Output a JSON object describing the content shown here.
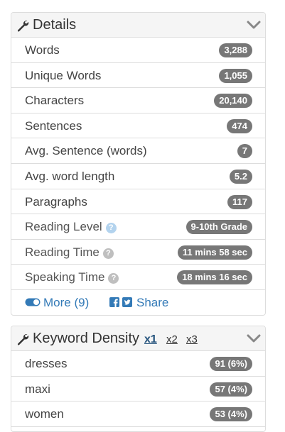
{
  "details": {
    "title": "Details",
    "rows": [
      {
        "label": "Words",
        "value": "3,288"
      },
      {
        "label": "Unique Words",
        "value": "1,055"
      },
      {
        "label": "Characters",
        "value": "20,140"
      },
      {
        "label": "Sentences",
        "value": "474"
      },
      {
        "label": "Avg. Sentence (words)",
        "value": "7"
      },
      {
        "label": "Avg. word length",
        "value": "5.2"
      },
      {
        "label": "Paragraphs",
        "value": "117"
      },
      {
        "label": "Reading Level",
        "value": "9-10th Grade"
      },
      {
        "label": "Reading Time",
        "value": "11 mins 58 sec"
      },
      {
        "label": "Speaking Time",
        "value": "18 mins 16 sec"
      }
    ],
    "more_label": "More (9)",
    "share_label": "Share"
  },
  "keyword_density": {
    "title": "Keyword Density",
    "tabs": [
      "x1",
      "x2",
      "x3"
    ],
    "active_tab": "x1",
    "rows": [
      {
        "label": "dresses",
        "value": "91 (6%)"
      },
      {
        "label": "maxi",
        "value": "57 (4%)"
      },
      {
        "label": "women",
        "value": "53 (4%)"
      }
    ]
  },
  "colors": {
    "badge": "#777777",
    "link": "#337ab7",
    "heading_bg": "#f5f5f5",
    "border": "#dddddd"
  },
  "icons": [
    "wrench-icon",
    "chevron-down-icon",
    "help-icon",
    "toggle-on-icon",
    "facebook-icon",
    "twitter-icon"
  ]
}
